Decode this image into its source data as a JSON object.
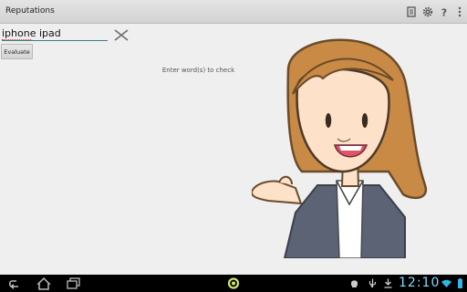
{
  "app": {
    "title": "Reputations"
  },
  "actions": {
    "notes_icon": "notes-icon",
    "settings_icon": "gear-icon",
    "help_icon": "help-icon",
    "overflow_icon": "overflow-menu-icon"
  },
  "form": {
    "input_value": "iphone ipad",
    "clear_icon": "close-icon",
    "evaluate_label": "Evaluate",
    "hint": "Enter word(s) to check"
  },
  "system_bar": {
    "time": "12:10",
    "nav_icons": [
      "back-icon",
      "home-icon",
      "recent-apps-icon"
    ],
    "status_icons": [
      "android-debug-icon",
      "usb-icon",
      "download-icon",
      "wifi-icon",
      "battery-icon"
    ]
  },
  "colors": {
    "accent": "#3a7f86",
    "clock": "#7fdbff",
    "hair": "#c98a45",
    "suit": "#5b6374"
  }
}
